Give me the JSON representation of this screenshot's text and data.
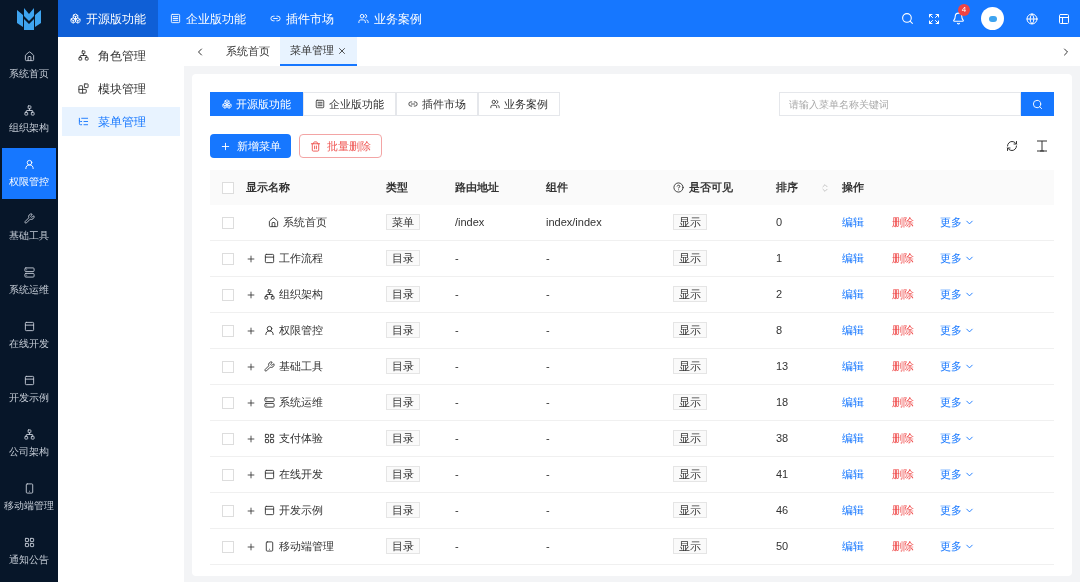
{
  "top_nav": [
    {
      "label": "开源版功能",
      "selected": true
    },
    {
      "label": "企业版功能",
      "selected": false
    },
    {
      "label": "插件市场",
      "selected": false
    },
    {
      "label": "业务案例",
      "selected": false
    }
  ],
  "notification_count": "4",
  "rail": [
    {
      "label": "系统首页",
      "selected": false
    },
    {
      "label": "组织架构",
      "selected": false
    },
    {
      "label": "权限管控",
      "selected": true
    },
    {
      "label": "基础工具",
      "selected": false
    },
    {
      "label": "系统运维",
      "selected": false
    },
    {
      "label": "在线开发",
      "selected": false
    },
    {
      "label": "开发示例",
      "selected": false
    },
    {
      "label": "公司架构",
      "selected": false
    },
    {
      "label": "移动端管理",
      "selected": false
    },
    {
      "label": "通知公告",
      "selected": false
    }
  ],
  "submenu": [
    {
      "label": "角色管理",
      "selected": false
    },
    {
      "label": "模块管理",
      "selected": false
    },
    {
      "label": "菜单管理",
      "selected": true
    }
  ],
  "page_tabs": [
    {
      "label": "系统首页",
      "selected": false,
      "closable": false
    },
    {
      "label": "菜单管理",
      "selected": true,
      "closable": true
    }
  ],
  "filter_tabs": [
    {
      "label": "开源版功能",
      "selected": true
    },
    {
      "label": "企业版功能",
      "selected": false
    },
    {
      "label": "插件市场",
      "selected": false
    },
    {
      "label": "业务案例",
      "selected": false
    }
  ],
  "search": {
    "placeholder": "请输入菜单名称关键词"
  },
  "actions": {
    "add": "新增菜单",
    "batch_delete": "批量删除"
  },
  "table": {
    "all_checked": false,
    "columns": [
      "显示名称",
      "类型",
      "路由地址",
      "组件",
      "是否可见",
      "排序",
      "操作"
    ],
    "rows": [
      {
        "checked": false,
        "name": "系统首页",
        "expandable": false,
        "type": "菜单",
        "route": "/index",
        "component": "index/index",
        "visible": "显示",
        "sort": "0",
        "edit": "编辑",
        "delete": "删除",
        "more": "更多"
      },
      {
        "checked": false,
        "name": "工作流程",
        "expandable": true,
        "type": "目录",
        "route": "-",
        "component": "-",
        "visible": "显示",
        "sort": "1",
        "edit": "编辑",
        "delete": "删除",
        "more": "更多"
      },
      {
        "checked": false,
        "name": "组织架构",
        "expandable": true,
        "type": "目录",
        "route": "-",
        "component": "-",
        "visible": "显示",
        "sort": "2",
        "edit": "编辑",
        "delete": "删除",
        "more": "更多"
      },
      {
        "checked": false,
        "name": "权限管控",
        "expandable": true,
        "type": "目录",
        "route": "-",
        "component": "-",
        "visible": "显示",
        "sort": "8",
        "edit": "编辑",
        "delete": "删除",
        "more": "更多"
      },
      {
        "checked": false,
        "name": "基础工具",
        "expandable": true,
        "type": "目录",
        "route": "-",
        "component": "-",
        "visible": "显示",
        "sort": "13",
        "edit": "编辑",
        "delete": "删除",
        "more": "更多"
      },
      {
        "checked": false,
        "name": "系统运维",
        "expandable": true,
        "type": "目录",
        "route": "-",
        "component": "-",
        "visible": "显示",
        "sort": "18",
        "edit": "编辑",
        "delete": "删除",
        "more": "更多"
      },
      {
        "checked": false,
        "name": "支付体验",
        "expandable": true,
        "type": "目录",
        "route": "-",
        "component": "-",
        "visible": "显示",
        "sort": "38",
        "edit": "编辑",
        "delete": "删除",
        "more": "更多"
      },
      {
        "checked": false,
        "name": "在线开发",
        "expandable": true,
        "type": "目录",
        "route": "-",
        "component": "-",
        "visible": "显示",
        "sort": "41",
        "edit": "编辑",
        "delete": "删除",
        "more": "更多"
      },
      {
        "checked": false,
        "name": "开发示例",
        "expandable": true,
        "type": "目录",
        "route": "-",
        "component": "-",
        "visible": "显示",
        "sort": "46",
        "edit": "编辑",
        "delete": "删除",
        "more": "更多"
      },
      {
        "checked": false,
        "name": "移动端管理",
        "expandable": true,
        "type": "目录",
        "route": "-",
        "component": "-",
        "visible": "显示",
        "sort": "50",
        "edit": "编辑",
        "delete": "删除",
        "more": "更多"
      }
    ]
  }
}
